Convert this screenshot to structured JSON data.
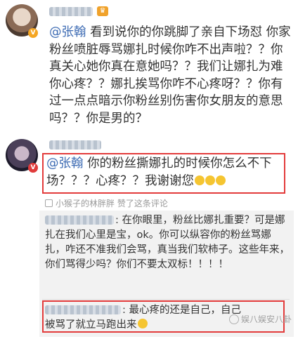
{
  "post1": {
    "avatar_icon": "user-avatar-female",
    "badge_icon": "verified-v-icon",
    "crown_icon": "member-crown-icon",
    "mention": "@张翰",
    "text": "看到说你的你跳脚了亲自下场怼 你家粉丝喷脏辱骂娜扎时候你咋不出声啦？？你真关心她你真在意她吗？？我们让娜扎为难你心疼？？娜扎挨骂你咋不心疼呀？？你有过一点点暗示你粉丝别伤害你女朋友的意思吗？？你是男的？"
  },
  "post2": {
    "avatar_icon": "user-avatar-male",
    "badge_icon": "verified-v-icon",
    "mention": "@张翰",
    "text": "你的粉丝撕娜扎的时候你怎么不下场？？？心疼？？我谢谢您",
    "liked_by": "小猴子的林胖胖 赞了这条评论",
    "replies": [
      {
        "text": ": 在你眼里，粉丝比娜扎重要？可是娜扎在我们心里是宝，ok。你可以纵容你的粉丝骂娜扎，咋还不准我们会骂，真当我们软柿子。这些年来，你们骂得少吗？你们不要太双标！！！！"
      },
      {
        "text": ": 最心疼的还是自己，自己被骂了就立马跑出来"
      }
    ]
  },
  "watermark": "娱八娱安八卦",
  "colors": {
    "mention": "#3d6bb3",
    "highlight_box": "#e33b3b",
    "reply_bg": "#f2f2f2"
  }
}
